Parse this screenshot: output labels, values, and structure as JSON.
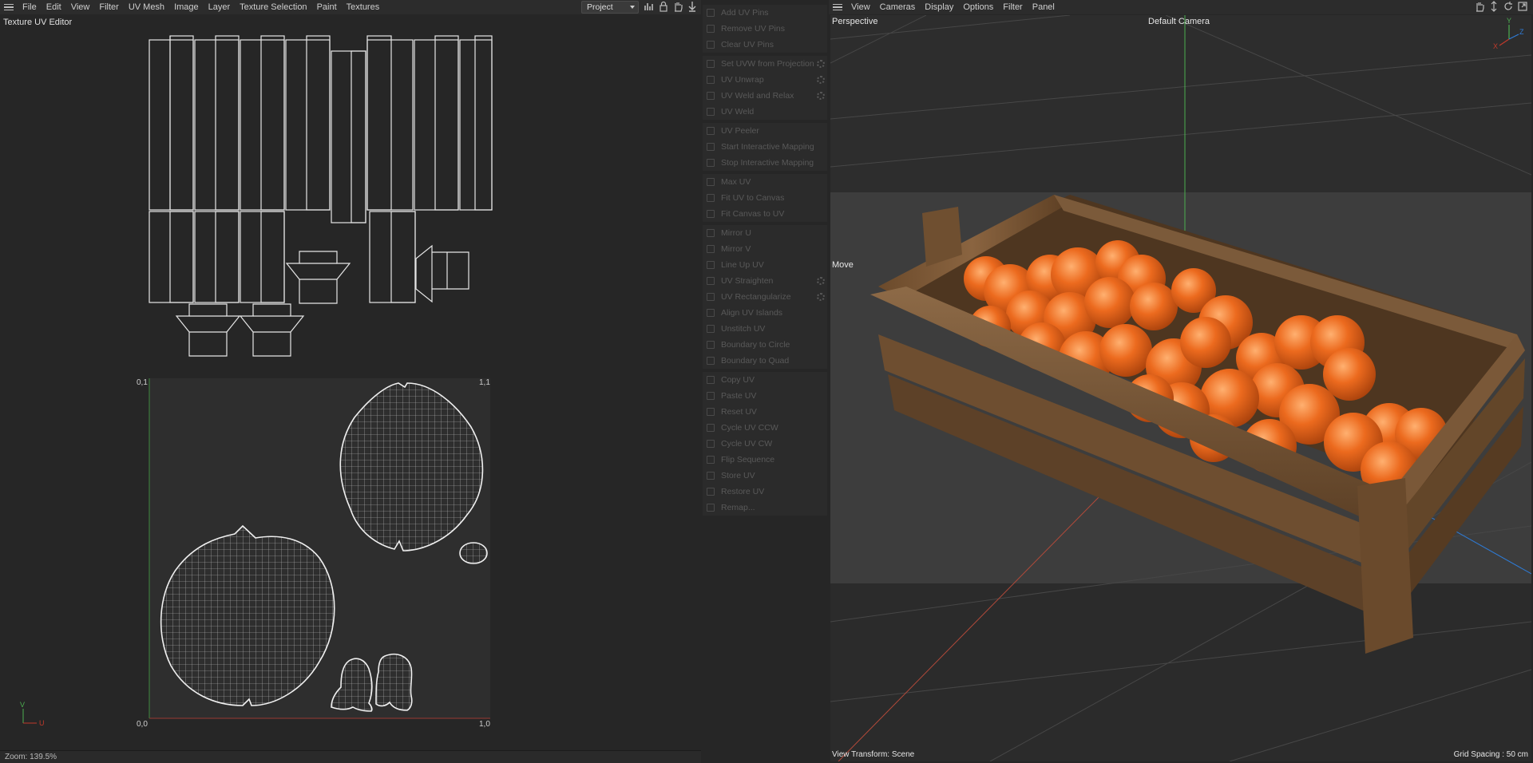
{
  "uv_editor": {
    "menu": [
      "File",
      "Edit",
      "View",
      "Filter",
      "UV Mesh",
      "Image",
      "Layer",
      "Texture Selection",
      "Paint",
      "Textures"
    ],
    "title": "Texture UV Editor",
    "project_select": "Project",
    "tool_icons": [
      "histogram-icon",
      "lock-icon",
      "hand-pan-icon",
      "pin-down-icon"
    ],
    "ticks": {
      "top_left": "0,1",
      "top_right": "1,1",
      "bottom_left": "0,0",
      "bottom_right": "1,0"
    },
    "axis_labels": {
      "v": "V",
      "u": "U"
    },
    "status": "Zoom: 139.5%"
  },
  "uv_commands": {
    "sections": [
      {
        "items": [
          {
            "label": "Add UV Pins",
            "icon": "pin-icon",
            "settings": false
          },
          {
            "label": "Remove UV Pins",
            "icon": "pin-remove-icon",
            "settings": false
          },
          {
            "label": "Clear UV Pins",
            "icon": "clear-icon",
            "settings": false
          }
        ]
      },
      {
        "items": [
          {
            "label": "Set UVW from Projection",
            "icon": "projection-icon",
            "settings": true
          },
          {
            "label": "UV Unwrap",
            "icon": "unwrap-icon",
            "settings": true
          },
          {
            "label": "UV Weld and Relax",
            "icon": "weld-relax-icon",
            "settings": true
          },
          {
            "label": "UV Weld",
            "icon": "weld-icon",
            "settings": false
          }
        ]
      },
      {
        "items": [
          {
            "label": "UV Peeler",
            "icon": "peeler-icon",
            "settings": false
          },
          {
            "label": "Start Interactive Mapping",
            "icon": "play-icon",
            "settings": false
          },
          {
            "label": "Stop Interactive Mapping",
            "icon": "stop-icon",
            "settings": false
          }
        ]
      },
      {
        "items": [
          {
            "label": "Max UV",
            "icon": "max-uv-icon",
            "settings": false
          },
          {
            "label": "Fit UV to Canvas",
            "icon": "fit-uv-icon",
            "settings": false
          },
          {
            "label": "Fit Canvas to UV",
            "icon": "fit-canvas-icon",
            "settings": false
          }
        ]
      },
      {
        "items": [
          {
            "label": "Mirror U",
            "icon": "mirror-u-icon",
            "settings": false
          },
          {
            "label": "Mirror V",
            "icon": "mirror-v-icon",
            "settings": false
          },
          {
            "label": "Line Up UV",
            "icon": "line-up-icon",
            "settings": false
          },
          {
            "label": "UV Straighten",
            "icon": "straighten-icon",
            "settings": true
          },
          {
            "label": "UV Rectangularize",
            "icon": "rectangularize-icon",
            "settings": true
          },
          {
            "label": "Align UV Islands",
            "icon": "align-icon",
            "settings": false
          },
          {
            "label": "Unstitch UV",
            "icon": "unstitch-icon",
            "settings": false
          },
          {
            "label": "Boundary to Circle",
            "icon": "circle-icon",
            "settings": false
          },
          {
            "label": "Boundary to Quad",
            "icon": "quad-icon",
            "settings": false
          }
        ]
      },
      {
        "items": [
          {
            "label": "Copy UV",
            "icon": "copy-icon",
            "settings": false
          },
          {
            "label": "Paste UV",
            "icon": "paste-icon",
            "settings": false
          },
          {
            "label": "Reset UV",
            "icon": "reset-icon",
            "settings": false
          },
          {
            "label": "Cycle UV CCW",
            "icon": "cycle-ccw-icon",
            "settings": false
          },
          {
            "label": "Cycle UV CW",
            "icon": "cycle-cw-icon",
            "settings": false
          },
          {
            "label": "Flip Sequence",
            "icon": "flip-icon",
            "settings": false
          },
          {
            "label": "Store UV",
            "icon": "store-icon",
            "settings": false
          },
          {
            "label": "Restore UV",
            "icon": "restore-icon",
            "settings": false
          },
          {
            "label": "Remap...",
            "icon": "remap-icon",
            "settings": false
          }
        ]
      }
    ]
  },
  "viewport": {
    "menu": [
      "View",
      "Cameras",
      "Display",
      "Options",
      "Filter",
      "Panel"
    ],
    "projection": "Perspective",
    "camera": "Default Camera",
    "tool": "Move",
    "view_transform": "View Transform: Scene",
    "grid_spacing": "Grid Spacing : 50 cm",
    "axis_gizmo": {
      "y": "Y",
      "x": "X",
      "z": "Z"
    },
    "tool_icons": [
      "hand-pan-icon",
      "move-arrows-icon",
      "rotate-icon",
      "maximize-icon"
    ],
    "colors": {
      "axis_x": "#c0392b",
      "axis_y": "#4caf50",
      "axis_z": "#2e7bd6",
      "orange": "#e8671c",
      "wood": "#7a5533"
    }
  }
}
